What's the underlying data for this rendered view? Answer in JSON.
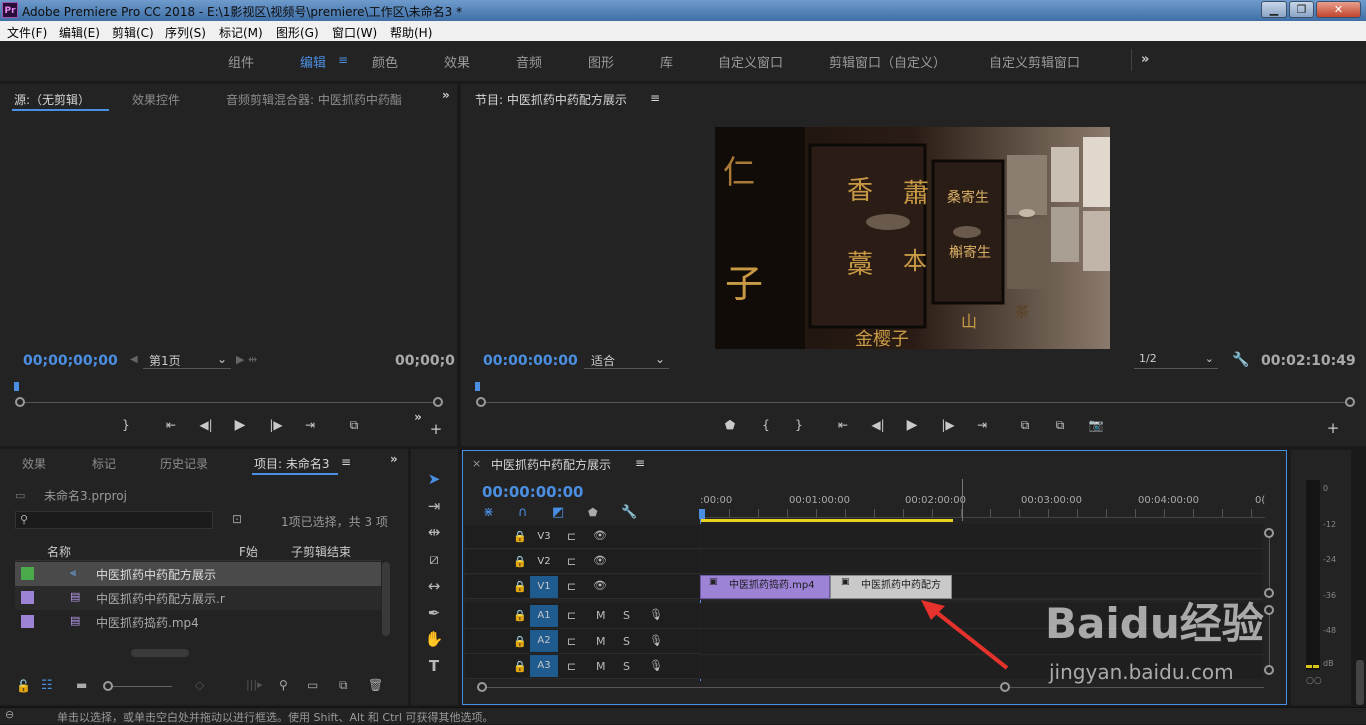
{
  "window": {
    "title": "Adobe Premiere Pro CC 2018 - E:\\1影视区\\视频号\\premiere\\工作区\\未命名3 *",
    "app_icon_label": "Pr"
  },
  "menu": [
    "文件(F)",
    "编辑(E)",
    "剪辑(C)",
    "序列(S)",
    "标记(M)",
    "图形(G)",
    "窗口(W)",
    "帮助(H)"
  ],
  "workspaces": [
    "组件",
    "编辑",
    "颜色",
    "效果",
    "音频",
    "图形",
    "库",
    "自定义窗口",
    "剪辑窗口（自定义）",
    "自定义剪辑窗口"
  ],
  "workspace_active": "编辑",
  "source_panel": {
    "tabs": [
      "源:（无剪辑）",
      "效果控件",
      "音频剪辑混合器: 中医抓药中药酯"
    ],
    "timecode_left": "00;00;00;00",
    "page_select": "第1页",
    "timecode_right": "00;00;0"
  },
  "program_panel": {
    "title": "节目: 中医抓药中药配方展示",
    "timecode": "00:00:00:00",
    "fit": "适合",
    "resolution": "1/2",
    "duration": "00:02:10:49",
    "preview_text": [
      "香",
      "蕭",
      "藁",
      "本",
      "仁",
      "子",
      "桑寄生",
      "槲寄生",
      "金樱子",
      "山",
      "茶"
    ]
  },
  "project_panel": {
    "tabs": [
      "效果",
      "标记",
      "历史记录",
      "项目: 未命名3"
    ],
    "project_file": "未命名3.prproj",
    "selection_info": "1项已选择，共 3 项",
    "columns": [
      "名称",
      "F始",
      "子剪辑结束"
    ],
    "items": [
      {
        "name": "中医抓药中药配方展示",
        "color": "#4aa94a",
        "type": "sequence"
      },
      {
        "name": "中医抓药中药配方展示.r",
        "color": "#9d83d6",
        "type": "clip"
      },
      {
        "name": "中医抓药捣药.mp4",
        "color": "#9d83d6",
        "type": "clip"
      }
    ]
  },
  "timeline": {
    "title": "中医抓药中药配方展示",
    "timecode": "00:00:00:00",
    "ruler": [
      ":00:00",
      "00:01:00:00",
      "00:02:00:00",
      "00:03:00:00",
      "00:04:00:00",
      "0("
    ],
    "video_tracks": [
      "V3",
      "V2",
      "V1"
    ],
    "audio_tracks": [
      "A1",
      "A2",
      "A3"
    ],
    "clips": [
      {
        "name": "中医抓药捣药.mp4",
        "color": "#9d83d6"
      },
      {
        "name": "中医抓药中药配方",
        "color": "#c9c9c9"
      }
    ]
  },
  "audio_meter": {
    "labels": [
      "0",
      "-12",
      "-24",
      "-36",
      "-48",
      "dB"
    ]
  },
  "status_bar": {
    "text": "单击以选择，或单击空白处并拖动以进行框选。使用 Shift、Alt 和 Ctrl 可获得其他选项。"
  },
  "watermark": {
    "brand": "Baidu经验",
    "url": "jingyan.baidu.com"
  }
}
